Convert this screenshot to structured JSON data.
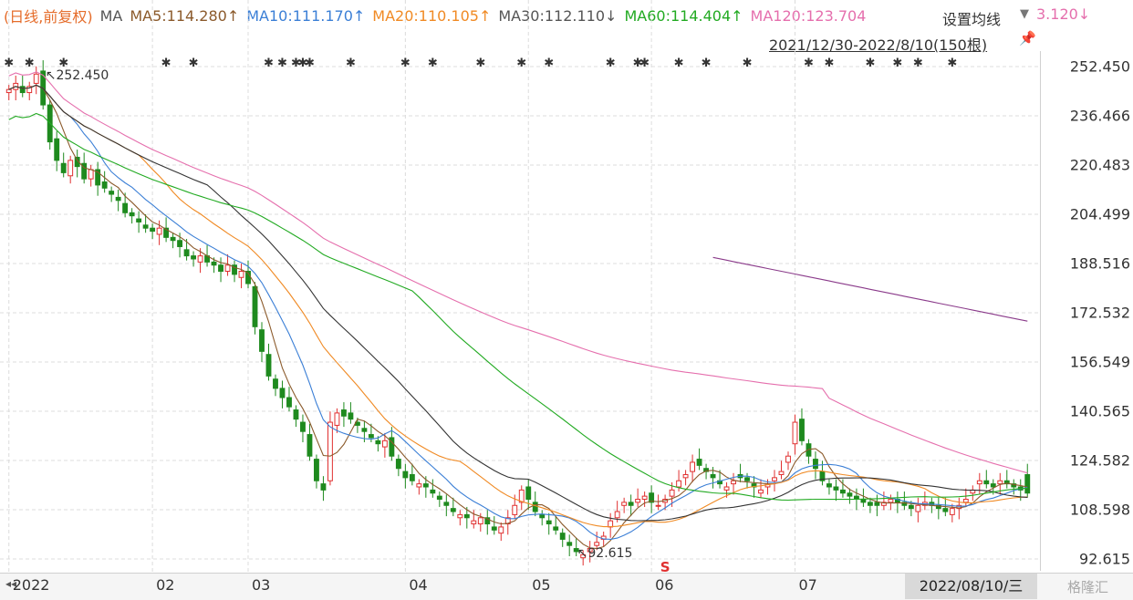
{
  "legend": {
    "period": "(日线,前复权)",
    "ma_label": "MA",
    "ma5": "MA5:114.280↑",
    "ma10": "MA10:111.170↑",
    "ma20": "MA20:110.105↑",
    "ma30": "MA30:112.110↓",
    "ma60": "MA60:114.404↑",
    "ma120": "MA120:123.704",
    "ma120_tail": "3.120↓"
  },
  "settings_label": "设置均线",
  "settings_arrow": "▼",
  "range_label": "2021/12/30-2022/8/10(150根)",
  "pin_icon": "📌",
  "x_nav": "◂◂",
  "date_box": "2022/08/10/三",
  "watermark": "格隆汇",
  "colors": {
    "up": "#e03030",
    "down": "#1e8a1e",
    "ma5": "#8b5a2b",
    "ma10": "#3b7fd6",
    "ma20": "#f08a24",
    "ma30": "#333333",
    "ma60": "#22aa22",
    "ma120": "#e56fad",
    "ma250": "#8a3a8a"
  },
  "chart_data": {
    "type": "candlestick",
    "title": "",
    "y_ticks": [
      "252.450",
      "236.466",
      "220.483",
      "204.499",
      "188.516",
      "172.532",
      "156.549",
      "140.565",
      "124.582",
      "108.598",
      "92.615"
    ],
    "ylim": [
      92.615,
      252.45
    ],
    "x_ticks": [
      {
        "label": "2022",
        "bar": 0
      },
      {
        "label": "02",
        "bar": 21
      },
      {
        "label": "03",
        "bar": 35
      },
      {
        "label": "04",
        "bar": 58
      },
      {
        "label": "05",
        "bar": 76
      },
      {
        "label": "06",
        "bar": 94
      },
      {
        "label": "07",
        "bar": 115
      }
    ],
    "bar_count": 150,
    "annotations": {
      "high": {
        "label": "252.450",
        "bar": 4,
        "value": 252.45
      },
      "low": {
        "label": "92.615",
        "bar": 85,
        "value": 92.615
      },
      "s_marker": {
        "label": "S",
        "bar": 96
      }
    },
    "event_marks": [
      0,
      3,
      8,
      23,
      27,
      38,
      40,
      42,
      43,
      44,
      50,
      58,
      62,
      69,
      75,
      79,
      88,
      92,
      93,
      98,
      102,
      108,
      117,
      120,
      126,
      130,
      133,
      138
    ],
    "close": [
      245,
      247,
      244,
      246,
      250,
      240,
      228,
      222,
      218,
      222,
      220,
      216,
      219,
      214,
      213,
      211,
      209,
      205,
      204,
      202,
      200,
      199,
      200,
      197,
      196,
      194,
      191,
      190,
      191,
      189,
      188,
      186,
      188,
      185,
      186,
      182,
      168,
      160,
      152,
      148,
      145,
      142,
      138,
      134,
      126,
      118,
      115,
      137,
      140,
      139,
      138,
      136,
      134,
      132,
      130,
      131,
      126,
      122,
      119,
      118,
      117,
      116,
      114,
      112,
      110,
      108,
      107,
      106,
      105,
      106,
      104,
      102,
      103,
      106,
      110,
      115,
      112,
      108,
      106,
      104,
      102,
      99,
      97,
      95,
      94,
      96,
      98,
      100,
      105,
      108,
      111,
      110,
      112,
      113,
      111,
      110,
      112,
      115,
      118,
      120,
      124,
      123,
      121,
      119,
      117,
      116,
      118,
      119,
      118,
      116,
      115,
      117,
      119,
      121,
      126,
      137,
      131,
      126,
      122,
      118,
      116,
      115,
      114,
      113,
      112,
      111,
      110,
      110,
      111,
      112,
      111,
      110,
      109,
      110,
      111,
      110,
      109,
      108,
      109,
      110,
      112,
      115,
      118,
      117,
      116,
      118,
      117,
      116,
      115,
      114
    ],
    "open": [
      244,
      245,
      246,
      244,
      247,
      251,
      240,
      229,
      221,
      217,
      223,
      221,
      216,
      219,
      215,
      212,
      210,
      208,
      205,
      203,
      201,
      200,
      198,
      200,
      197,
      196,
      193,
      191,
      189,
      191,
      189,
      188,
      186,
      188,
      184,
      186,
      181,
      167,
      159,
      151,
      148,
      145,
      141,
      137,
      133,
      125,
      117,
      118,
      136,
      141,
      140,
      137,
      135,
      133,
      131,
      129,
      132,
      125,
      121,
      120,
      116,
      117,
      115,
      113,
      111,
      109,
      106,
      107,
      104,
      104,
      106,
      103,
      101,
      104,
      107,
      111,
      116,
      111,
      107,
      105,
      103,
      101,
      98,
      96,
      93,
      95,
      97,
      99,
      103,
      106,
      110,
      111,
      111,
      112,
      114,
      110,
      111,
      113,
      116,
      119,
      121,
      125,
      122,
      120,
      118,
      115,
      117,
      120,
      119,
      117,
      114,
      116,
      118,
      120,
      124,
      130,
      138,
      130,
      125,
      121,
      117,
      116,
      115,
      114,
      113,
      112,
      111,
      111,
      110,
      111,
      112,
      111,
      110,
      108,
      110,
      111,
      110,
      109,
      107,
      109,
      111,
      114,
      117,
      118,
      117,
      117,
      118,
      117,
      116,
      120
    ]
  }
}
